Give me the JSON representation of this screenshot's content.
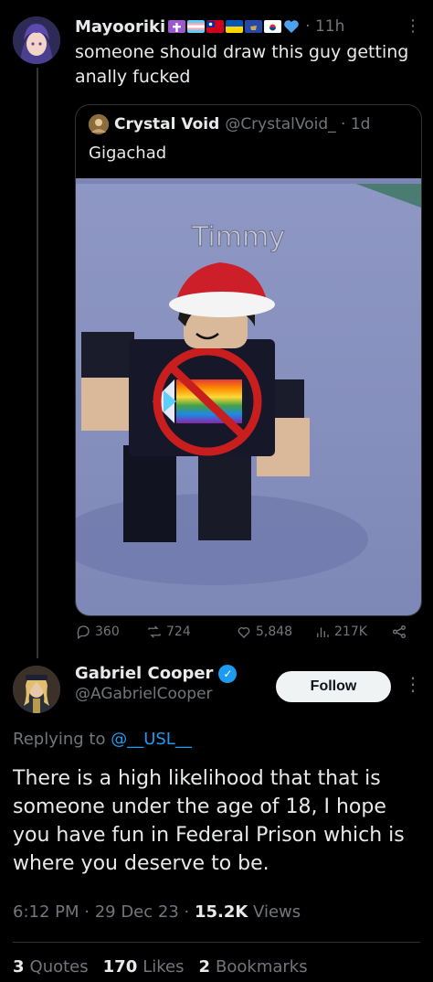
{
  "tweet1": {
    "author_name": "Mayooriki",
    "time": "· 11h",
    "text": "someone should draw this guy getting anally fucked",
    "more": "⋮"
  },
  "quote": {
    "author_name": "Crystal Void",
    "handle_time": "@CrystalVoid_ · 1d",
    "text": "Gigachad",
    "image_caption": "Timmy"
  },
  "stats": {
    "replies": "360",
    "reposts": "724",
    "likes": "5,848",
    "views": "217K"
  },
  "tweet2": {
    "author_name": "Gabriel Cooper",
    "handle": "@AGabrielCooper",
    "follow_label": "Follow",
    "more": "⋮",
    "replying_prefix": "Replying to ",
    "replying_mention": "@__USL__",
    "text": "There is a high likelihood that that is someone under the age of 18, I hope you have fun in Federal Prison which is where you deserve to be.",
    "time_date": "6:12 PM · 29 Dec 23 · ",
    "views_count": "15.2K",
    "views_label": " Views"
  },
  "engagement": {
    "quotes_count": "3",
    "quotes_label": "Quotes",
    "likes_count": "170",
    "likes_label": "Likes",
    "bookmarks_count": "2",
    "bookmarks_label": "Bookmarks"
  },
  "colors": {
    "background": "#000000",
    "text": "#e7e9ea",
    "muted": "#71767b",
    "accent": "#1d9bf0"
  }
}
